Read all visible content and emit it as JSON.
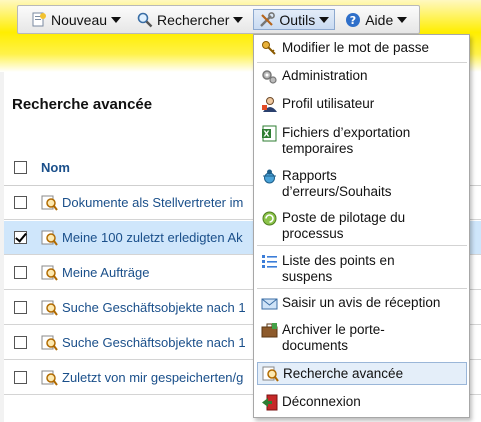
{
  "toolbar": {
    "items": [
      {
        "label": "Nouveau",
        "icon": "new-document-icon"
      },
      {
        "label": "Rechercher",
        "icon": "magnifier-icon"
      },
      {
        "label": "Outils",
        "icon": "tools-icon"
      },
      {
        "label": "Aide",
        "icon": "help-icon"
      }
    ]
  },
  "page": {
    "title": "Recherche avancée"
  },
  "list": {
    "header": "Nom",
    "rows": [
      {
        "label": "Dokumente als Stellvertreter im",
        "checked": false
      },
      {
        "label": "Meine 100 zuletzt erledigten Ak",
        "checked": true
      },
      {
        "label": "Meine Aufträge",
        "checked": false
      },
      {
        "label": "Suche Geschäftsobjekte nach 1",
        "checked": false
      },
      {
        "label": "Suche Geschäftsobjekte nach 1",
        "checked": false
      },
      {
        "label": "Zuletzt von mir gespeicherten/g",
        "checked": false
      }
    ]
  },
  "menu": {
    "items": [
      {
        "line1": "Modifier le mot de passe",
        "line2": "",
        "icon": "key-icon"
      },
      {
        "line1": "Administration",
        "line2": "",
        "icon": "gears-icon"
      },
      {
        "line1": "Profil utilisateur",
        "line2": "",
        "icon": "user-profile-icon"
      },
      {
        "line1": "Fichiers d’exportation",
        "line2": "temporaires",
        "icon": "excel-icon"
      },
      {
        "line1": "Rapports",
        "line2": "d’erreurs/Souhaits",
        "icon": "bug-icon"
      },
      {
        "line1": "Poste de pilotage du",
        "line2": "processus",
        "icon": "cockpit-icon"
      },
      {
        "line1": "Liste des points en",
        "line2": "suspens",
        "icon": "list-icon"
      },
      {
        "line1": "Saisir un avis de réception",
        "line2": "",
        "icon": "envelope-icon"
      },
      {
        "line1": "Archiver le porte-",
        "line2": "documents",
        "icon": "briefcase-icon"
      },
      {
        "line1": "Recherche avancée",
        "line2": "",
        "icon": "advanced-search-icon"
      },
      {
        "line1": "Déconnexion",
        "line2": "",
        "icon": "logout-icon"
      }
    ]
  },
  "colors": {
    "banner_yellow": "#ffee00",
    "link_blue": "#1a4f8a",
    "selected_row": "#cfe6fb"
  }
}
